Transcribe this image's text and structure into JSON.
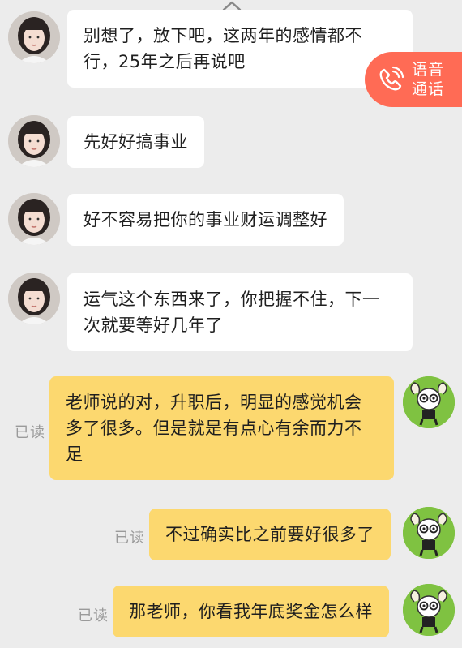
{
  "chat": {
    "incoming": [
      {
        "text": "别想了，放下吧，这两年的感情都不行，25年之后再说吧"
      },
      {
        "text": "先好好搞事业"
      },
      {
        "text": "好不容易把你的事业财运调整好"
      },
      {
        "text": "运气这个东西来了，你把握不住，下一次就要等好几年了"
      }
    ],
    "outgoing": [
      {
        "text": "老师说的对，升职后，明显的感觉机会多了很多。但是就是有点心有余而力不足",
        "status": "已读"
      },
      {
        "text": "不过确实比之前要好很多了",
        "status": "已读"
      },
      {
        "text": "那老师，你看我年底奖金怎么样",
        "status": "已读"
      }
    ]
  },
  "voice_call": {
    "label": "语音通话",
    "icon": "phone-icon",
    "color": "#ff6b55"
  },
  "colors": {
    "background": "#ececec",
    "incoming_bubble": "#ffffff",
    "outgoing_bubble": "#fcd86f",
    "read_status": "#9a9a9a"
  }
}
